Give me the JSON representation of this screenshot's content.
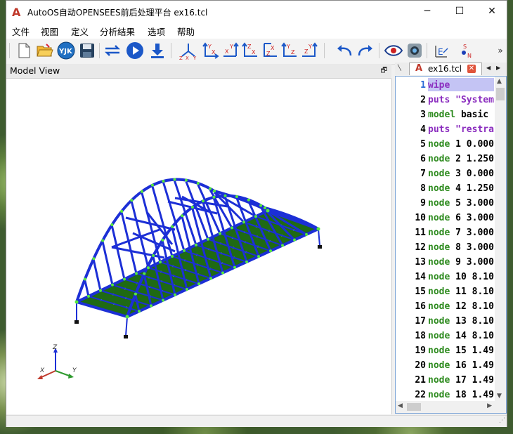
{
  "window": {
    "title": "AutoOS自动OPENSEES前后处理平台 ex16.tcl",
    "minimize": "─",
    "maximize": "☐",
    "close": "✕"
  },
  "menu": [
    "文件",
    "视图",
    "定义",
    "分析结果",
    "选项",
    "帮助"
  ],
  "toolbar": {
    "icons": [
      "new-file-icon",
      "open-folder-icon",
      "yjk-icon",
      "save-icon",
      "convert-icon",
      "run-icon",
      "download-icon",
      "axis-xyz-icon",
      "view-yx-icon",
      "view-xy-icon",
      "view-zx-icon",
      "view-xz-icon",
      "view-yz-icon",
      "view-zy-icon",
      "undo-icon",
      "redo-icon",
      "eye-icon",
      "camera-icon",
      "edit-icon",
      "section-icon"
    ],
    "overflow": "»"
  },
  "model_view": {
    "title": "Model View",
    "restore": "🗗",
    "axis_labels": {
      "z": "Z",
      "x": "X",
      "y": "Y"
    }
  },
  "editor": {
    "tab_name": "ex16.tcl",
    "lines": [
      {
        "n": "1",
        "kw": "wipe",
        "rest": "",
        "kwclass": "kw2",
        "restclass": "plain"
      },
      {
        "n": "2",
        "kw": "puts",
        "rest": " \"System",
        "kwclass": "kw2",
        "restclass": "str"
      },
      {
        "n": "3",
        "kw": "model",
        "rest": " basic",
        "kwclass": "kw",
        "restclass": "plain"
      },
      {
        "n": "4",
        "kw": "puts",
        "rest": " \"restra",
        "kwclass": "kw2",
        "restclass": "str"
      },
      {
        "n": "5",
        "kw": "node",
        "rest": " 1 0.000",
        "kwclass": "kw",
        "restclass": "plain"
      },
      {
        "n": "6",
        "kw": "node",
        "rest": " 2 1.250",
        "kwclass": "kw",
        "restclass": "plain"
      },
      {
        "n": "7",
        "kw": "node",
        "rest": " 3 0.000",
        "kwclass": "kw",
        "restclass": "plain"
      },
      {
        "n": "8",
        "kw": "node",
        "rest": " 4 1.250",
        "kwclass": "kw",
        "restclass": "plain"
      },
      {
        "n": "9",
        "kw": "node",
        "rest": " 5 3.000",
        "kwclass": "kw",
        "restclass": "plain"
      },
      {
        "n": "10",
        "kw": "node",
        "rest": " 6 3.000",
        "kwclass": "kw",
        "restclass": "plain"
      },
      {
        "n": "11",
        "kw": "node",
        "rest": " 7 3.000",
        "kwclass": "kw",
        "restclass": "plain"
      },
      {
        "n": "12",
        "kw": "node",
        "rest": " 8 3.000",
        "kwclass": "kw",
        "restclass": "plain"
      },
      {
        "n": "13",
        "kw": "node",
        "rest": " 9 3.000",
        "kwclass": "kw",
        "restclass": "plain"
      },
      {
        "n": "14",
        "kw": "node",
        "rest": " 10 8.10",
        "kwclass": "kw",
        "restclass": "plain"
      },
      {
        "n": "15",
        "kw": "node",
        "rest": " 11 8.10",
        "kwclass": "kw",
        "restclass": "plain"
      },
      {
        "n": "16",
        "kw": "node",
        "rest": " 12 8.10",
        "kwclass": "kw",
        "restclass": "plain"
      },
      {
        "n": "17",
        "kw": "node",
        "rest": " 13 8.10",
        "kwclass": "kw",
        "restclass": "plain"
      },
      {
        "n": "18",
        "kw": "node",
        "rest": " 14 8.10",
        "kwclass": "kw",
        "restclass": "plain"
      },
      {
        "n": "19",
        "kw": "node",
        "rest": " 15 1.49",
        "kwclass": "kw",
        "restclass": "plain"
      },
      {
        "n": "20",
        "kw": "node",
        "rest": " 16 1.49",
        "kwclass": "kw",
        "restclass": "plain"
      },
      {
        "n": "21",
        "kw": "node",
        "rest": " 17 1.49",
        "kwclass": "kw",
        "restclass": "plain"
      },
      {
        "n": "22",
        "kw": "node",
        "rest": " 18 1.49",
        "kwclass": "kw",
        "restclass": "plain"
      }
    ]
  }
}
